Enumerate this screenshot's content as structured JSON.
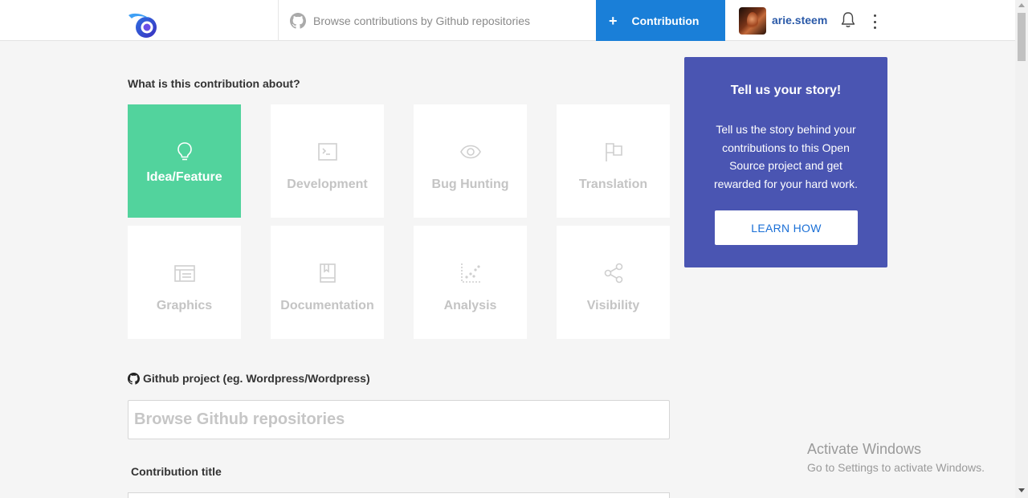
{
  "header": {
    "search_placeholder": "Browse contributions by Github repositories",
    "contribution_plus": "+",
    "contribution_label": "Contribution",
    "username": "arie.steem"
  },
  "main": {
    "question": "What is this contribution about?",
    "categories": [
      {
        "label": "Idea/Feature",
        "icon": "lightbulb-icon",
        "selected": true
      },
      {
        "label": "Development",
        "icon": "terminal-icon",
        "selected": false
      },
      {
        "label": "Bug Hunting",
        "icon": "eye-icon",
        "selected": false
      },
      {
        "label": "Translation",
        "icon": "flag-icon",
        "selected": false
      },
      {
        "label": "Graphics",
        "icon": "layout-icon",
        "selected": false
      },
      {
        "label": "Documentation",
        "icon": "book-icon",
        "selected": false
      },
      {
        "label": "Analysis",
        "icon": "scatter-chart-icon",
        "selected": false
      },
      {
        "label": "Visibility",
        "icon": "share-icon",
        "selected": false
      }
    ],
    "github_label": "Github project (eg. Wordpress/Wordpress)",
    "github_placeholder": "Browse Github repositories",
    "title_label": "Contribution title"
  },
  "story": {
    "title": "Tell us your story!",
    "body": "Tell us the story behind your contributions to this Open Source project and get rewarded for your hard work.",
    "button": "LEARN HOW"
  },
  "watermark": {
    "line1": "Activate Windows",
    "line2": "Go to Settings to activate Windows."
  },
  "colors": {
    "accent_blue": "#1a7fd8",
    "selected_green": "#52d39d",
    "story_purple": "#4a55b2",
    "username_blue": "#2a59a8"
  }
}
